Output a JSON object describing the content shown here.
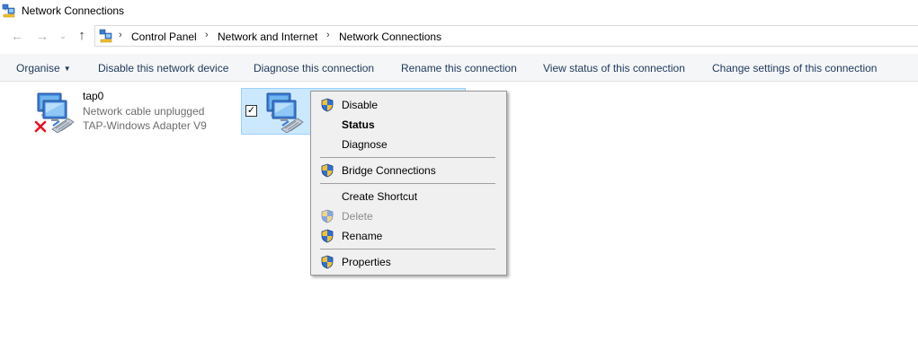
{
  "window": {
    "title": "Network Connections"
  },
  "nav": {
    "back_glyph": "←",
    "forward_glyph": "→",
    "recent_glyph": "⌄",
    "up_glyph": "↑",
    "crumb_separator": "›",
    "breadcrumbs": [
      "Control Panel",
      "Network and Internet",
      "Network Connections"
    ]
  },
  "toolbar": {
    "organise_label": "Organise",
    "organise_caret": "▼",
    "disable_label": "Disable this network device",
    "diagnose_label": "Diagnose this connection",
    "rename_label": "Rename this connection",
    "view_status_label": "View status of this connection",
    "change_settings_label": "Change settings of this connection"
  },
  "connections": [
    {
      "name": "tap0",
      "status": "Network cable unplugged",
      "adapter": "TAP-Windows Adapter V9",
      "disconnected_icon": "red-x-icon"
    },
    {
      "selected": true,
      "checkbox_mark": "✓"
    }
  ],
  "context_menu": {
    "items": [
      {
        "label": "Disable",
        "icon": "uac-shield-icon"
      },
      {
        "label": "Status"
      },
      {
        "label": "Diagnose"
      },
      {
        "label": "Bridge Connections",
        "icon": "uac-shield-icon"
      },
      {
        "label": "Create Shortcut"
      },
      {
        "label": "Delete",
        "icon": "uac-shield-icon",
        "disabled": true
      },
      {
        "label": "Rename",
        "icon": "uac-shield-icon"
      },
      {
        "label": "Properties",
        "icon": "uac-shield-icon"
      }
    ]
  },
  "colors": {
    "command_text": "#1e395b",
    "selection_fill": "#cce8ff",
    "selection_border": "#99d1ff",
    "menu_background": "#f0f0f0",
    "shield_blue": "#2f6fd6",
    "shield_gold": "#f2c230",
    "error_red": "#e81123"
  }
}
